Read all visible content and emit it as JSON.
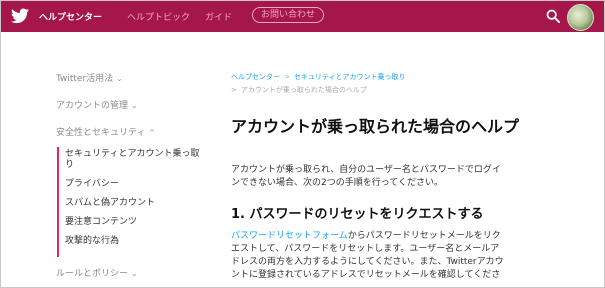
{
  "header": {
    "logo_icon": "twitter-bird-icon",
    "home_label": "ヘルプセンター",
    "topics_label": "ヘルプトピック",
    "guide_label": "ガイド",
    "contact_label": "お問い合わせ",
    "search_icon": "search-icon",
    "bar_color": "#a5164a"
  },
  "sidebar": {
    "categories": [
      {
        "label": "Twitter活用法",
        "chevron": "⌄"
      },
      {
        "label": "アカウントの管理",
        "chevron": "⌄"
      },
      {
        "label": "安全性とセキュリティ",
        "chevron": "^"
      },
      {
        "label": "ルールとポリシー",
        "chevron": "⌄"
      }
    ],
    "sub_items": [
      "セキュリティとアカウント乗っ取り",
      "プライバシー",
      "スパムと偽アカウント",
      "要注意コンテンツ",
      "攻撃的な行為"
    ],
    "accent_color": "#e0245e"
  },
  "breadcrumb": {
    "items": [
      "ヘルプセンター",
      "セキュリティとアカウント乗っ取り"
    ],
    "separator": ">",
    "current": "アカウントが乗っ取られた場合のヘルプ"
  },
  "article": {
    "title": "アカウントが乗っ取られた場合のヘルプ",
    "intro": "アカウントが乗っ取られ、自分のユーザー名とパスワードでログインできない場合、次の2つの手順を行ってください。",
    "step1_heading": "1. パスワードのリセットをリクエストする",
    "step1_link": "パスワードリセットフォーム",
    "step1_body": "からパスワードリセットメールをリクエストして、パスワードをリセットします。ユーザー名とメールアドレスの両方を入力するようにしてください。また、Twitterアカウントに登録されているアドレスでリセットメールを確認してくださ"
  }
}
